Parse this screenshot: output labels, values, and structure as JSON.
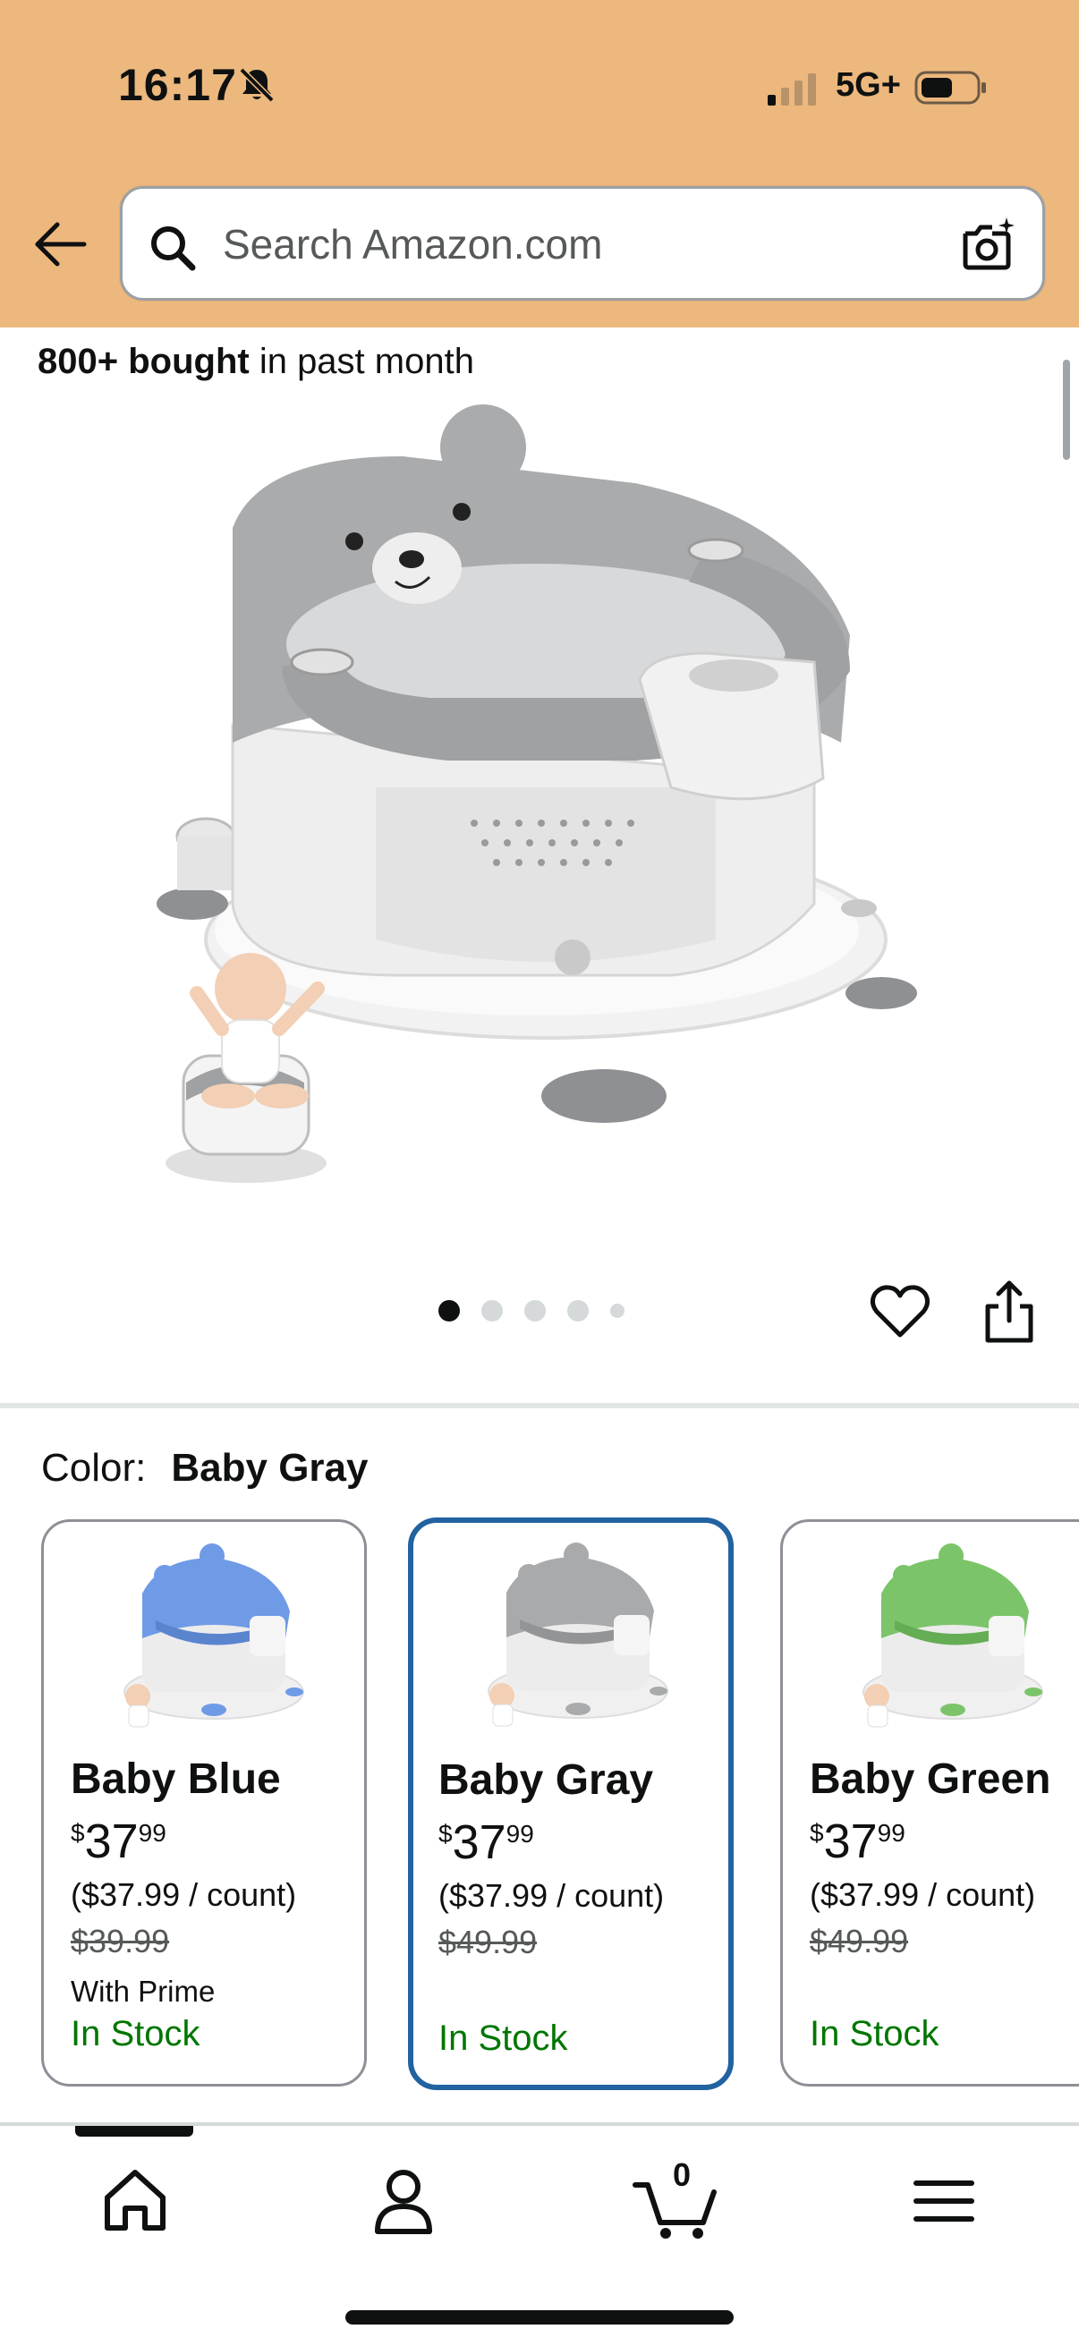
{
  "status_bar": {
    "time": "16:17",
    "network": "5G+"
  },
  "search": {
    "placeholder": "Search Amazon.com"
  },
  "product": {
    "bought_bold": "800+ bought",
    "bought_rest": " in past month",
    "image_count": 5,
    "active_image": 1
  },
  "color_selector": {
    "label": "Color:",
    "selected": "Baby Gray"
  },
  "swatches": [
    {
      "name": "Baby Blue",
      "currency": "$",
      "price_whole": "37",
      "price_fraction": "99",
      "unit_price": "($37.99 / count)",
      "list_price": "$39.99",
      "prime_note": "With Prime",
      "stock": "In Stock",
      "tint": "#6f9ae6"
    },
    {
      "name": "Baby Gray",
      "currency": "$",
      "price_whole": "37",
      "price_fraction": "99",
      "unit_price": "($37.99 / count)",
      "list_price": "$49.99",
      "prime_note": "",
      "stock": "In Stock",
      "tint": "#a8aaac"
    },
    {
      "name": "Baby Green",
      "currency": "$",
      "price_whole": "37",
      "price_fraction": "99",
      "unit_price": "($37.99 / count)",
      "list_price": "$49.99",
      "prime_note": "",
      "stock": "In Stock",
      "tint": "#7cc46a"
    }
  ],
  "bottom_nav": {
    "cart_count": "0",
    "items": [
      "home-icon",
      "account-icon",
      "cart-icon",
      "menu-icon"
    ]
  },
  "colors": {
    "header_bg": "#edb87d",
    "selected_border": "#2162a1",
    "in_stock": "#007600"
  }
}
